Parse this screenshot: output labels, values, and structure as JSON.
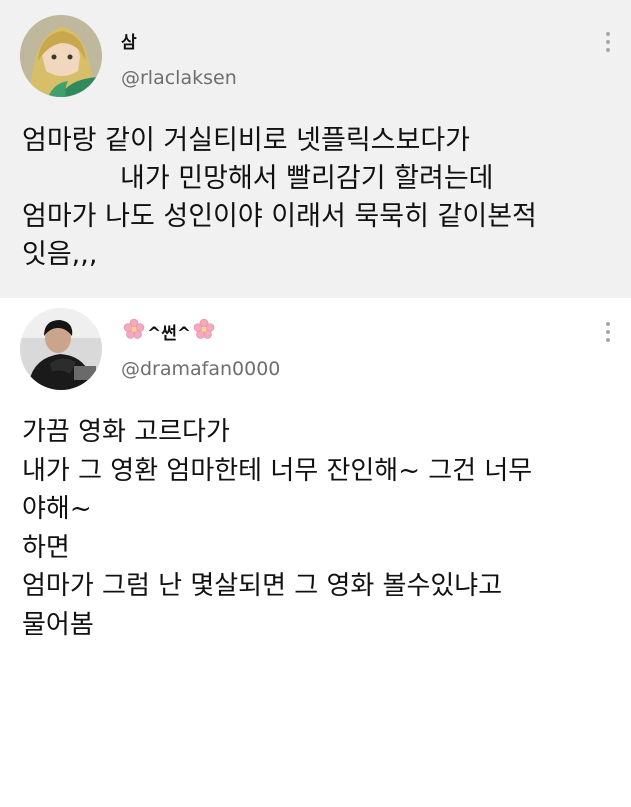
{
  "tweets": [
    {
      "display_name": "삼",
      "handle": "@rlaclaksen",
      "avatar": "anime-girl-avatar",
      "lines": [
        "엄마랑 같이 거실티비로 넷플릭스보다가",
        "내가 민망해서 빨리감기 할려는데",
        "엄마가 나도 성인이야 이래서 묵묵히 같이본적",
        "잇음,,,"
      ]
    },
    {
      "display_name": "^썬^",
      "handle": "@dramafan0000",
      "avatar": "man-avatar",
      "name_decoration": "cherry-blossom-icon",
      "lines": [
        "가끔 영화 고르다가",
        "내가 그 영환 엄마한테 너무 잔인해~ 그건 너무",
        "야해~",
        "하면",
        "엄마가 그럼 난 몇살되면 그 영화 볼수있냐고",
        "물어봄"
      ]
    }
  ],
  "colors": {
    "tweet1_bg": "#f1f1f1",
    "tweet2_bg": "#ffffff",
    "handle": "#6e6e6e",
    "text": "#111111",
    "more_icon": "#a7a7a7"
  }
}
